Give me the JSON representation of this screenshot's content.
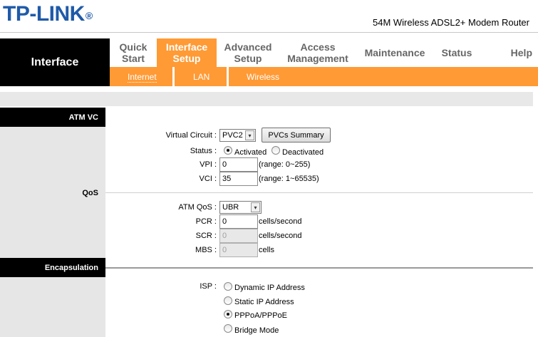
{
  "brand": {
    "logo": "TP-LINK",
    "reg_mark": "®",
    "model": "54M Wireless ADSL2+ Modem Router"
  },
  "left_title": "Interface",
  "nav": {
    "items": [
      {
        "label": "Quick\nStart"
      },
      {
        "label": "Interface\nSetup"
      },
      {
        "label": "Advanced\nSetup"
      },
      {
        "label": "Access\nManagement"
      },
      {
        "label": "Maintenance"
      },
      {
        "label": "Status"
      },
      {
        "label": "Help"
      }
    ],
    "active": "Interface Setup"
  },
  "subnav": {
    "items": [
      "Internet",
      "LAN",
      "Wireless"
    ],
    "active": "Internet"
  },
  "sections": {
    "atm_vc": "ATM VC",
    "qos": "QoS",
    "encapsulation": "Encapsulation"
  },
  "atm": {
    "virtual_circuit_label": "Virtual Circuit :",
    "virtual_circuit_value": "PVC2",
    "pvcs_button": "PVCs Summary",
    "status_label": "Status :",
    "status_activated": "Activated",
    "status_deactivated": "Deactivated",
    "vpi_label": "VPI :",
    "vpi_value": "0",
    "vpi_range": "(range: 0~255)",
    "vci_label": "VCI :",
    "vci_value": "35",
    "vci_range": "(range: 1~65535)"
  },
  "qos": {
    "atm_qos_label": "ATM QoS :",
    "atm_qos_value": "UBR",
    "pcr_label": "PCR :",
    "pcr_value": "0",
    "pcr_unit": "cells/second",
    "scr_label": "SCR :",
    "scr_value": "0",
    "scr_unit": "cells/second",
    "mbs_label": "MBS :",
    "mbs_value": "0",
    "mbs_unit": "cells"
  },
  "encap": {
    "isp_label": "ISP :",
    "options": [
      "Dynamic IP Address",
      "Static IP Address",
      "PPPoA/PPPoE",
      "Bridge Mode"
    ],
    "selected": "PPPoA/PPPoE"
  },
  "icons": {
    "dropdown": "chevron-down-icon"
  },
  "colors": {
    "accent": "#ff9a35",
    "logo": "#1f5aa8",
    "header_black": "#000000"
  }
}
